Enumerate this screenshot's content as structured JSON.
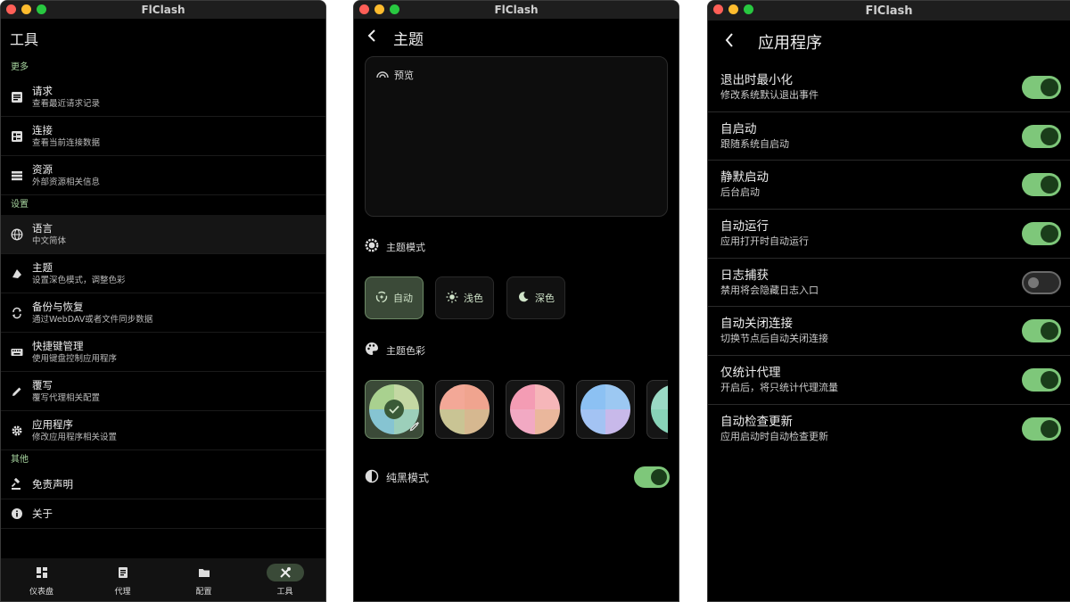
{
  "app_title": "FlClash",
  "colors": {
    "accent": "#7ec77a",
    "section_label": "#a8d6a0",
    "selected_bg": "#3b4a38"
  },
  "tools": {
    "title": "工具",
    "sections": {
      "more": "更多",
      "settings": "设置",
      "other": "其他"
    },
    "items": [
      {
        "title": "请求",
        "subtitle": "查看最近请求记录",
        "icon": "request-icon"
      },
      {
        "title": "连接",
        "subtitle": "查看当前连接数据",
        "icon": "connection-icon"
      },
      {
        "title": "资源",
        "subtitle": "外部资源相关信息",
        "icon": "resource-icon"
      },
      {
        "title": "语言",
        "subtitle": "中文简体",
        "icon": "globe-icon"
      },
      {
        "title": "主题",
        "subtitle": "设置深色模式，调整色彩",
        "icon": "theme-icon"
      },
      {
        "title": "备份与恢复",
        "subtitle": "通过WebDAV或者文件同步数据",
        "icon": "backup-icon"
      },
      {
        "title": "快捷键管理",
        "subtitle": "使用键盘控制应用程序",
        "icon": "keyboard-icon"
      },
      {
        "title": "覆写",
        "subtitle": "覆写代理相关配置",
        "icon": "pencil-icon"
      },
      {
        "title": "应用程序",
        "subtitle": "修改应用程序相关设置",
        "icon": "gear-icon"
      },
      {
        "title": "免责声明",
        "icon": "gavel-icon"
      },
      {
        "title": "关于",
        "icon": "info-icon"
      }
    ],
    "nav": [
      {
        "label": "仪表盘",
        "icon": "dashboard-icon"
      },
      {
        "label": "代理",
        "icon": "proxy-icon"
      },
      {
        "label": "配置",
        "icon": "folder-icon"
      },
      {
        "label": "工具",
        "icon": "tools-icon",
        "selected": true
      }
    ]
  },
  "theme": {
    "title": "主题",
    "preview_label": "预览",
    "mode_label": "主题模式",
    "modes": [
      {
        "label": "自动",
        "icon": "auto-mode-icon",
        "selected": true
      },
      {
        "label": "浅色",
        "icon": "sun-icon"
      },
      {
        "label": "深色",
        "icon": "moon-icon"
      }
    ],
    "color_label": "主题色彩",
    "pure_black_label": "纯黑模式",
    "pure_black_on": true
  },
  "application": {
    "title": "应用程序",
    "settings": [
      {
        "title": "退出时最小化",
        "subtitle": "修改系统默认退出事件",
        "on": true
      },
      {
        "title": "自启动",
        "subtitle": "跟随系统自启动",
        "on": true
      },
      {
        "title": "静默启动",
        "subtitle": "后台启动",
        "on": true
      },
      {
        "title": "自动运行",
        "subtitle": "应用打开时自动运行",
        "on": true
      },
      {
        "title": "日志捕获",
        "subtitle": "禁用将会隐藏日志入口",
        "on": false
      },
      {
        "title": "自动关闭连接",
        "subtitle": "切换节点后自动关闭连接",
        "on": true
      },
      {
        "title": "仅统计代理",
        "subtitle": "开启后，将只统计代理流量",
        "on": true
      },
      {
        "title": "自动检查更新",
        "subtitle": "应用启动时自动检查更新",
        "on": true
      }
    ]
  }
}
